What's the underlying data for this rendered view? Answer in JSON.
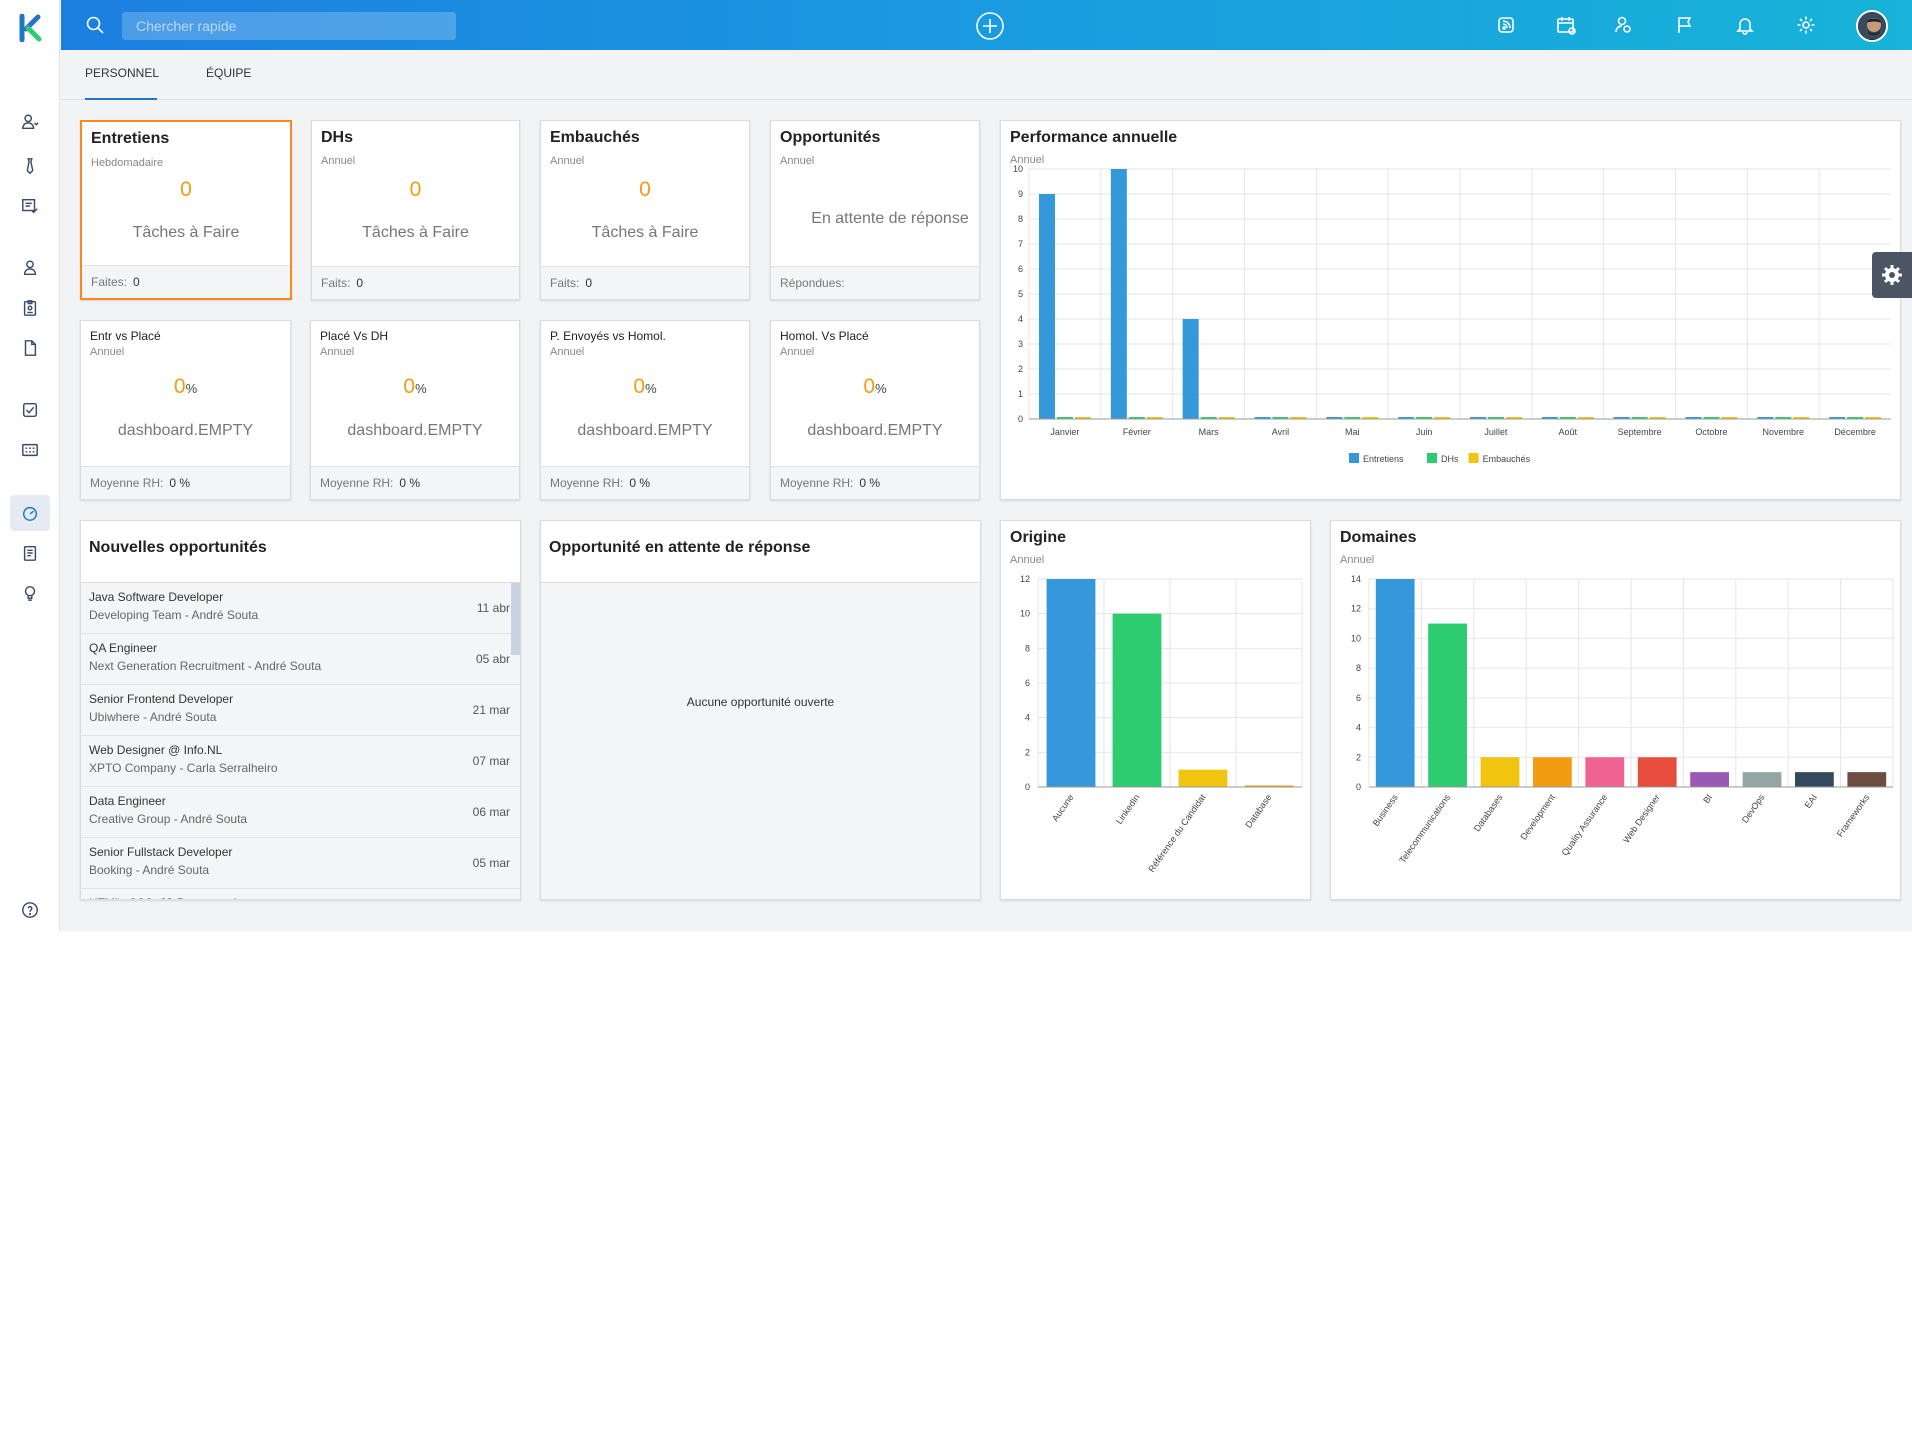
{
  "app": {
    "logo_letter": "K",
    "brand_color": "#1f77c6"
  },
  "sidebar": {
    "items": [
      {
        "icon": "user-dropdown-icon"
      },
      {
        "icon": "tie-icon"
      },
      {
        "icon": "checklist-icon"
      },
      {
        "icon": "user-icon"
      },
      {
        "icon": "badge-icon"
      },
      {
        "icon": "document-icon"
      },
      {
        "icon": "task-check-icon"
      },
      {
        "icon": "calendar-grid-icon"
      },
      {
        "icon": "dashboard-gauge-icon",
        "active": true
      },
      {
        "icon": "notes-icon"
      },
      {
        "icon": "lightbulb-icon"
      },
      {
        "icon": "help-icon"
      }
    ]
  },
  "topbar": {
    "search_placeholder": "Chercher rapide",
    "icons": [
      "search-icon",
      "add-circle-icon",
      "rss-icon",
      "calendar-icon",
      "contacts-icon",
      "flag-icon",
      "bell-icon",
      "settings-icon",
      "avatar"
    ]
  },
  "tabs": [
    {
      "label": "PERSONNEL",
      "active": true
    },
    {
      "label": "ÉQUIPE",
      "active": false
    }
  ],
  "stats_row1": [
    {
      "title": "Entretiens",
      "period": "Hebdomadaire",
      "value": "0",
      "label": "Tâches à Faire",
      "footer_label": "Faites:",
      "footer_value": "0"
    },
    {
      "title": "DHs",
      "period": "Annuel",
      "value": "0",
      "label": "Tâches à Faire",
      "footer_label": "Faits:",
      "footer_value": "0"
    },
    {
      "title": "Embauchés",
      "period": "Annuel",
      "value": "0",
      "label": "Tâches à Faire",
      "footer_label": "Faits:",
      "footer_value": "0"
    },
    {
      "title": "Opportunités",
      "period": "Annuel",
      "label": "En attente de réponse",
      "footer_label": "Répondues:",
      "footer_value": ""
    }
  ],
  "stats_row2": [
    {
      "title": "Entr vs Placé",
      "period": "Annuel",
      "value": "0",
      "unit": "%",
      "label": "dashboard.EMPTY",
      "footer_label": "Moyenne RH:",
      "footer_value": "0 %"
    },
    {
      "title": "Placé Vs DH",
      "period": "Annuel",
      "value": "0",
      "unit": "%",
      "label": "dashboard.EMPTY",
      "footer_label": "Moyenne RH:",
      "footer_value": "0 %"
    },
    {
      "title": "P. Envoyés vs Homol.",
      "period": "Annuel",
      "value": "0",
      "unit": "%",
      "label": "dashboard.EMPTY",
      "footer_label": "Moyenne RH:",
      "footer_value": "0 %"
    },
    {
      "title": "Homol. Vs Placé",
      "period": "Annuel",
      "value": "0",
      "unit": "%",
      "label": "dashboard.EMPTY",
      "footer_label": "Moyenne RH:",
      "footer_value": "0 %"
    }
  ],
  "new_opportunities": {
    "title": "Nouvelles opportunités",
    "items": [
      {
        "title": "Java Software Developer",
        "subtitle": "Developing Team - André Souta",
        "date": "11 abr"
      },
      {
        "title": "QA Engineer",
        "subtitle": "Next Generation Recruitment - André Souta",
        "date": "05 abr"
      },
      {
        "title": "Senior Frontend Developer",
        "subtitle": "Ubiwhere - André Souta",
        "date": "21 mar"
      },
      {
        "title": "Web Designer @ Info.NL",
        "subtitle": "XPTO Company - Carla Serralheiro",
        "date": "07 mar"
      },
      {
        "title": "Data Engineer",
        "subtitle": "Creative Group - André Souta",
        "date": "06 mar"
      },
      {
        "title": "Senior Fullstack Developer",
        "subtitle": "Booking - André Souta",
        "date": "05 mar"
      },
      {
        "title": "HTML, CSS, JS Programador",
        "subtitle": "",
        "date": ""
      }
    ]
  },
  "pending_opportunities": {
    "title": "Opportunité en attente de réponse",
    "empty": "Aucune opportunité ouverte"
  },
  "chart_data": [
    {
      "type": "bar",
      "title": "Performance annuelle",
      "subtitle": "Annuel",
      "categories": [
        "Janvier",
        "Février",
        "Mars",
        "Avril",
        "Mai",
        "Juin",
        "Juillet",
        "Août",
        "Septembre",
        "Octobre",
        "Novembre",
        "Décembre"
      ],
      "series": [
        {
          "name": "Entretiens",
          "color": "#3498db",
          "values": [
            9,
            10,
            4,
            0,
            0,
            0,
            0,
            0,
            0,
            0,
            0,
            0
          ]
        },
        {
          "name": "DHs",
          "color": "#2ecc71",
          "values": [
            0,
            0,
            0,
            0,
            0,
            0,
            0,
            0,
            0,
            0,
            0,
            0
          ]
        },
        {
          "name": "Embauchés",
          "color": "#f1c40f",
          "values": [
            0,
            0,
            0,
            0,
            0,
            0,
            0,
            0,
            0,
            0,
            0,
            0
          ]
        }
      ],
      "ylim": [
        0,
        10
      ],
      "yticks": [
        "0",
        "1",
        "2",
        "3",
        "4",
        "5",
        "6",
        "7",
        "8",
        "9",
        "10"
      ],
      "grid": true,
      "legend": "bottom"
    },
    {
      "type": "bar",
      "title": "Origine",
      "subtitle": "Annuel",
      "categories": [
        "Aucune",
        "LinkedIn",
        "Référence du Candidat",
        "Database"
      ],
      "values": [
        12,
        10,
        1,
        0
      ],
      "colors": [
        "#3498db",
        "#2ecc71",
        "#f1c40f",
        "#f39c12"
      ],
      "ylim": [
        0,
        12
      ],
      "yticks": [
        "0",
        "2",
        "4",
        "6",
        "8",
        "10",
        "12"
      ],
      "grid": true
    },
    {
      "type": "bar",
      "title": "Domaines",
      "subtitle": "Annuel",
      "categories": [
        "Business",
        "Telecommunications",
        "Databases",
        "Development",
        "Quality Assurance",
        "Web Designer",
        "BI",
        "DevOps",
        "EAI",
        "Frameworks"
      ],
      "values": [
        14,
        11,
        2,
        2,
        2,
        2,
        1,
        1,
        1,
        1
      ],
      "colors": [
        "#3498db",
        "#2ecc71",
        "#f1c40f",
        "#f39c12",
        "#f06292",
        "#e74c3c",
        "#9b59b6",
        "#95a5a6",
        "#34495e",
        "#6d4c41"
      ],
      "ylim": [
        0,
        14
      ],
      "yticks": [
        "0",
        "2",
        "4",
        "6",
        "8",
        "10",
        "12",
        "14"
      ],
      "grid": true
    }
  ]
}
